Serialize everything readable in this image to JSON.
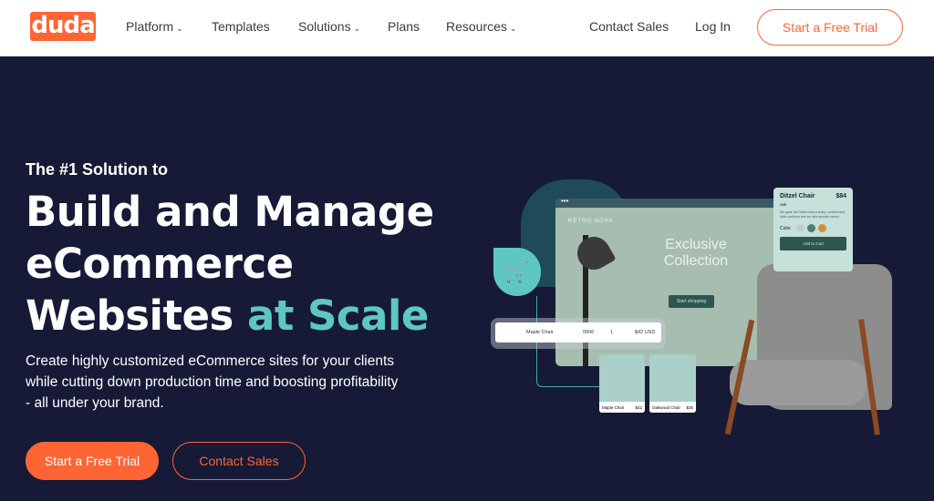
{
  "nav": {
    "logo": "duda",
    "items": [
      {
        "label": "Platform",
        "chev": true
      },
      {
        "label": "Templates"
      },
      {
        "label": "Solutions",
        "chev": true
      },
      {
        "label": "Plans"
      },
      {
        "label": "Resources",
        "chev": true
      }
    ],
    "contact": "Contact Sales",
    "login": "Log In",
    "cta": "Start a Free Trial"
  },
  "hero": {
    "eyebrow": "The #1 Solution to",
    "line1": "Build and Manage",
    "line2": "eCommerce",
    "line3a": "Websites ",
    "line3b": "at Scale",
    "para1": "Create highly customized eCommerce sites for your clients",
    "para2": "while cutting down production time and boosting profitability",
    "para3": "- all under your brand.",
    "cta_primary": "Start a Free Trial",
    "cta_secondary": "Contact Sales"
  },
  "illustration": {
    "brand": "RETRO NOVA",
    "headline1": "Exclusive",
    "headline2": "Collection",
    "shop": "Start shopping",
    "order": {
      "name": "Maple Chair",
      "sku": "0006",
      "qty": "1",
      "price": "$42 USD"
    },
    "cards": [
      {
        "name": "Maple Chair",
        "price": "$42"
      },
      {
        "name": "Oakwood Chair",
        "price": "$35"
      }
    ],
    "product": {
      "name": "Ditzel Chair",
      "price": "$84",
      "material": "oak",
      "desc": "We gave the Ditzel chair a cushy curved back, thick cushions and an ultra-smooth swivel.",
      "color_label": "Color",
      "colors": [
        "#c9c9cf",
        "#4f7e70",
        "#d8902f"
      ],
      "button": "Add to Cart"
    }
  },
  "colors": {
    "accent": "#ff6533",
    "teal": "#5ec8c0",
    "bg": "#161a36"
  }
}
